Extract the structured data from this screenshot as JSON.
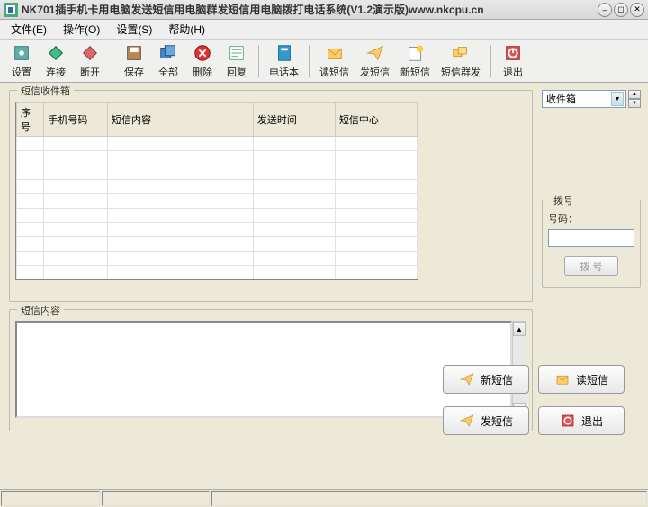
{
  "title": "NK701插手机卡用电脑发送短信用电脑群发短信用电脑拨打电话系统(V1.2演示版)www.nkcpu.cn",
  "menu": {
    "file": "文件(E)",
    "operate": "操作(O)",
    "settings": "设置(S)",
    "help": "帮助(H)"
  },
  "toolbar": {
    "setup": "设置",
    "connect": "连接",
    "disconnect": "断开",
    "save": "保存",
    "all": "全部",
    "delete": "删除",
    "reply": "回复",
    "phonebook": "电话本",
    "read_sms": "读短信",
    "send_sms": "发短信",
    "new_sms": "新短信",
    "group_send": "短信群发",
    "exit": "退出"
  },
  "groups": {
    "inbox": "短信收件箱",
    "content": "短信内容",
    "dial": "拨号"
  },
  "table": {
    "col_index": "序号",
    "col_phone": "手机号码",
    "col_content": "短信内容",
    "col_time": "发送时间",
    "col_center": "短信中心",
    "rows": 12
  },
  "combo": {
    "selected": "收件箱"
  },
  "dial": {
    "label": "号码：",
    "value": "",
    "button": "拨 号"
  },
  "actions": {
    "new_sms": "新短信",
    "read_sms": "读短信",
    "send_sms": "发短信",
    "exit": "退出"
  },
  "textarea_value": ""
}
